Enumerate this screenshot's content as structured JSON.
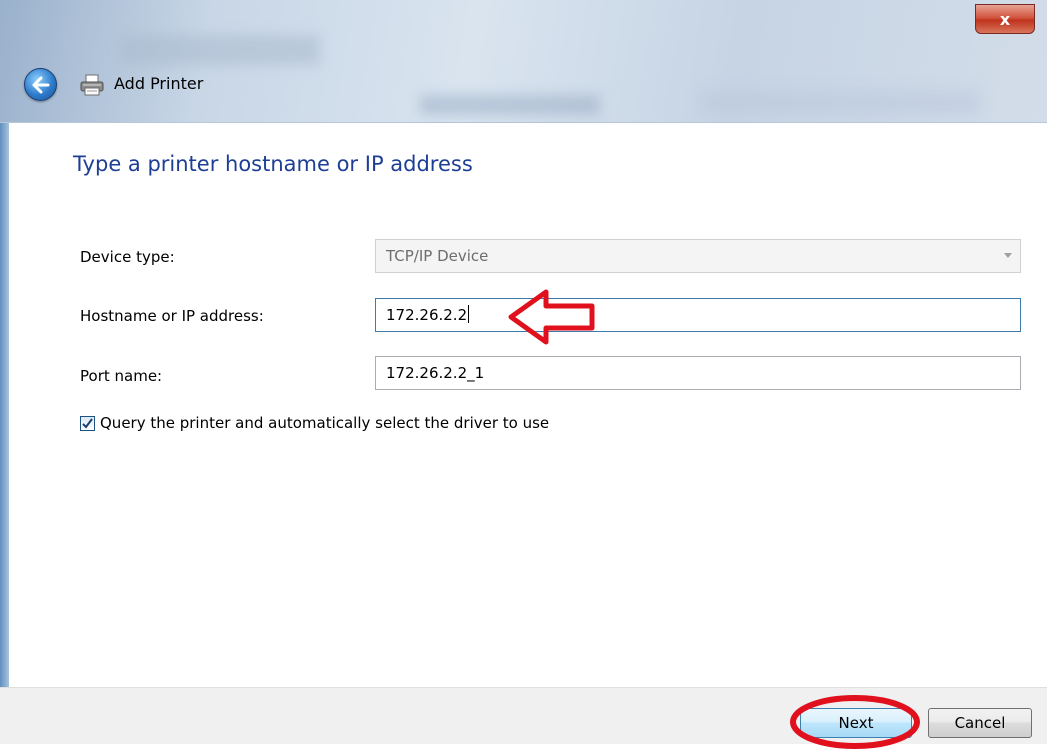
{
  "window": {
    "title": "Add Printer",
    "close_glyph": "x"
  },
  "heading": "Type a printer hostname or IP address",
  "form": {
    "device_type_label": "Device type:",
    "device_type_value": "TCP/IP Device",
    "hostname_label": "Hostname or IP address:",
    "hostname_value": "172.26.2.2",
    "port_label": "Port name:",
    "port_value": "172.26.2.2_1",
    "query_checkbox_label": "Query the printer and automatically select the driver to use",
    "query_checked": true
  },
  "buttons": {
    "next": "Next",
    "cancel": "Cancel"
  },
  "icons": {
    "back": "back-arrow-icon",
    "printer": "printer-icon",
    "checkbox": "checkmark-icon"
  },
  "colors": {
    "heading": "#1e3e96",
    "annotation": "#e0101c"
  }
}
